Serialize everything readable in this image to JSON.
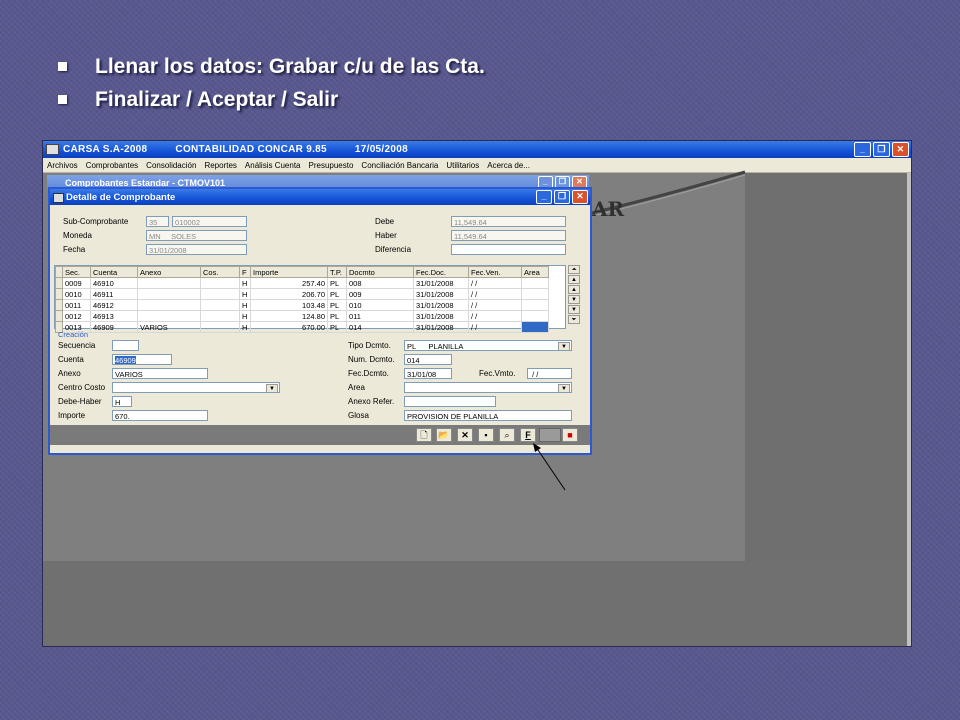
{
  "slide": {
    "bullets": [
      "Llenar los datos: Grabar c/u de las Cta.",
      "Finalizar / Aceptar / Salir"
    ]
  },
  "app": {
    "title_company": "CARSA S.A-2008",
    "title_program": "CONTABILIDAD CONCAR 9.85",
    "title_date": "17/05/2008",
    "menu": [
      "Archivos",
      "Comprobantes",
      "Consolidación",
      "Reportes",
      "Análisis Cuenta",
      "Presupuesto",
      "Conciliación Bancaria",
      "Utilitarios",
      "Acerca de..."
    ],
    "background_text": "AR"
  },
  "back_window": {
    "title": "Comprobantes Estandar - CTMOV101"
  },
  "dialog": {
    "title": "Detalle de Comprobante",
    "header": {
      "subcomprobante_label": "Sub-Comprobante",
      "subcomprobante_code": "35",
      "subcomprobante_num": "010002",
      "moneda_label": "Moneda",
      "moneda_value": "MN     SOLES",
      "fecha_label": "Fecha",
      "fecha_value": "31/01/2008",
      "debe_label": "Debe",
      "debe_value": "11,549.64",
      "haber_label": "Haber",
      "haber_value": "11,549.64",
      "diferencia_label": "Diferencia",
      "diferencia_value": ""
    },
    "grid": {
      "columns": [
        "Sec.",
        "Cuenta",
        "Anexo",
        "Cos.",
        "F",
        "Importe",
        "T.P.",
        "Docmto",
        "Fec.Doc.",
        "Fec.Ven.",
        "Area"
      ],
      "rows": [
        [
          "0009",
          "46910",
          "",
          "",
          "H",
          "257.40",
          "PL",
          "008",
          "31/01/2008",
          "/ /",
          ""
        ],
        [
          "0010",
          "46911",
          "",
          "",
          "H",
          "206.70",
          "PL",
          "009",
          "31/01/2008",
          "/ /",
          ""
        ],
        [
          "0011",
          "46912",
          "",
          "",
          "H",
          "103.48",
          "PL",
          "010",
          "31/01/2008",
          "/ /",
          ""
        ],
        [
          "0012",
          "46913",
          "",
          "",
          "H",
          "124.80",
          "PL",
          "011",
          "31/01/2008",
          "/ /",
          ""
        ],
        [
          "0013",
          "46909",
          "VARIOS",
          "",
          "H",
          "670.00",
          "PL",
          "014",
          "31/01/2008",
          "/ /",
          ""
        ]
      ]
    },
    "creacion_label": "Creación",
    "form": {
      "secuencia_label": "Secuencia",
      "secuencia_value": "",
      "cuenta_label": "Cuenta",
      "cuenta_value": "46909",
      "anexo_label": "Anexo",
      "anexo_value": "VARIOS",
      "centro_costo_label": "Centro Costo",
      "centro_costo_value": "",
      "debe_haber_label": "Debe-Haber",
      "debe_haber_value": "H",
      "importe_label": "Importe",
      "importe_value": "670.",
      "tipo_dcmto_label": "Tipo Dcmto.",
      "tipo_dcmto_value": "PL      PLANILLA",
      "num_dcmto_label": "Num. Dcmto.",
      "num_dcmto_value": "014",
      "fec_dcmto_label": "Fec.Dcmto.",
      "fec_dcmto_value": "31/01/08",
      "fec_vmto_label": "Fec.Vmto.",
      "fec_vmto_value": " / /",
      "area_label": "Area",
      "area_value": "",
      "anexo_refer_label": "Anexo Refer.",
      "anexo_refer_value": "",
      "glosa_label": "Glosa",
      "glosa_value": "PROVISION DE PLANILLA"
    },
    "toolbar": {
      "buttons": [
        "new-icon",
        "open-icon",
        "delete-icon",
        "save-icon",
        "find-icon",
        "f-button",
        "exit-icon"
      ],
      "f_label": "F"
    }
  }
}
